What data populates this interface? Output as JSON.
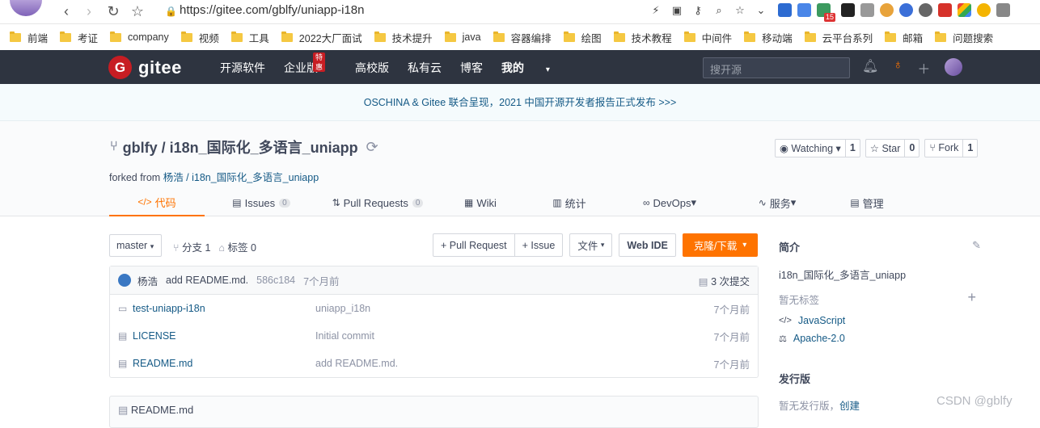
{
  "browser": {
    "url": "https://gitee.com/gblfy/uniapp-i18n",
    "bookmarks": [
      "前端",
      "考证",
      "company",
      "视频",
      "工具",
      "2022大厂面试",
      "技术提升",
      "java",
      "容器编排",
      "绘图",
      "技术教程",
      "中间件",
      "移动端",
      "云平台系列",
      "邮箱",
      "问题搜索"
    ],
    "ext_badge": "15"
  },
  "header": {
    "logo_text": "gitee",
    "nav": [
      "开源软件",
      "企业版",
      "高校版",
      "私有云",
      "博客",
      "我的"
    ],
    "hot_badge": "特惠",
    "search_placeholder": "搜开源"
  },
  "banner": {
    "text": "OSCHINA & Gitee 联合呈现，2021 中国开源开发者报告正式发布 >>>"
  },
  "project": {
    "title": "gblfy / i18n_国际化_多语言_uniapp",
    "forked_prefix": "forked from",
    "forked_link": "杨浩 / i18n_国际化_多语言_uniapp",
    "watching_label": "Watching",
    "watching_count": "1",
    "star_label": "Star",
    "star_count": "0",
    "fork_label": "Fork",
    "fork_count": "1",
    "tabs": [
      {
        "icon": "</>",
        "label": "代码"
      },
      {
        "icon": "▤",
        "label": "Issues",
        "count": "0"
      },
      {
        "icon": "⇅",
        "label": "Pull Requests",
        "count": "0"
      },
      {
        "icon": "▦",
        "label": "Wiki"
      },
      {
        "icon": "▥",
        "label": "统计"
      },
      {
        "icon": "∞",
        "label": "DevOps"
      },
      {
        "icon": "∿",
        "label": "服务"
      },
      {
        "icon": "▤",
        "label": "管理"
      }
    ]
  },
  "code": {
    "branch": "master",
    "branches": "分支 1",
    "tags": "标签 0",
    "pull_request_btn": "+ Pull Request",
    "issue_btn": "+ Issue",
    "file_btn": "文件",
    "webide_btn": "Web IDE",
    "clone_btn": "克隆/下载",
    "commit": {
      "author": "杨浩",
      "message": "add README.md.",
      "sha": "586c184",
      "time": "7个月前",
      "count": "3 次提交"
    },
    "files": [
      {
        "type": "folder",
        "name": "test-uniapp-i18n",
        "message": "uniapp_i18n",
        "time": "7个月前"
      },
      {
        "type": "file",
        "name": "LICENSE",
        "message": "Initial commit",
        "time": "7个月前"
      },
      {
        "type": "file",
        "name": "README.md",
        "message": "add README.md.",
        "time": "7个月前"
      }
    ],
    "readme_title": "README.md"
  },
  "sidebar": {
    "intro_title": "简介",
    "description": "i18n_国际化_多语言_uniapp",
    "no_tags": "暂无标签",
    "language": "JavaScript",
    "license": "Apache-2.0",
    "release_title": "发行版",
    "no_release": "暂无发行版，",
    "create_link": "创建"
  },
  "watermark": "CSDN @gblfy"
}
